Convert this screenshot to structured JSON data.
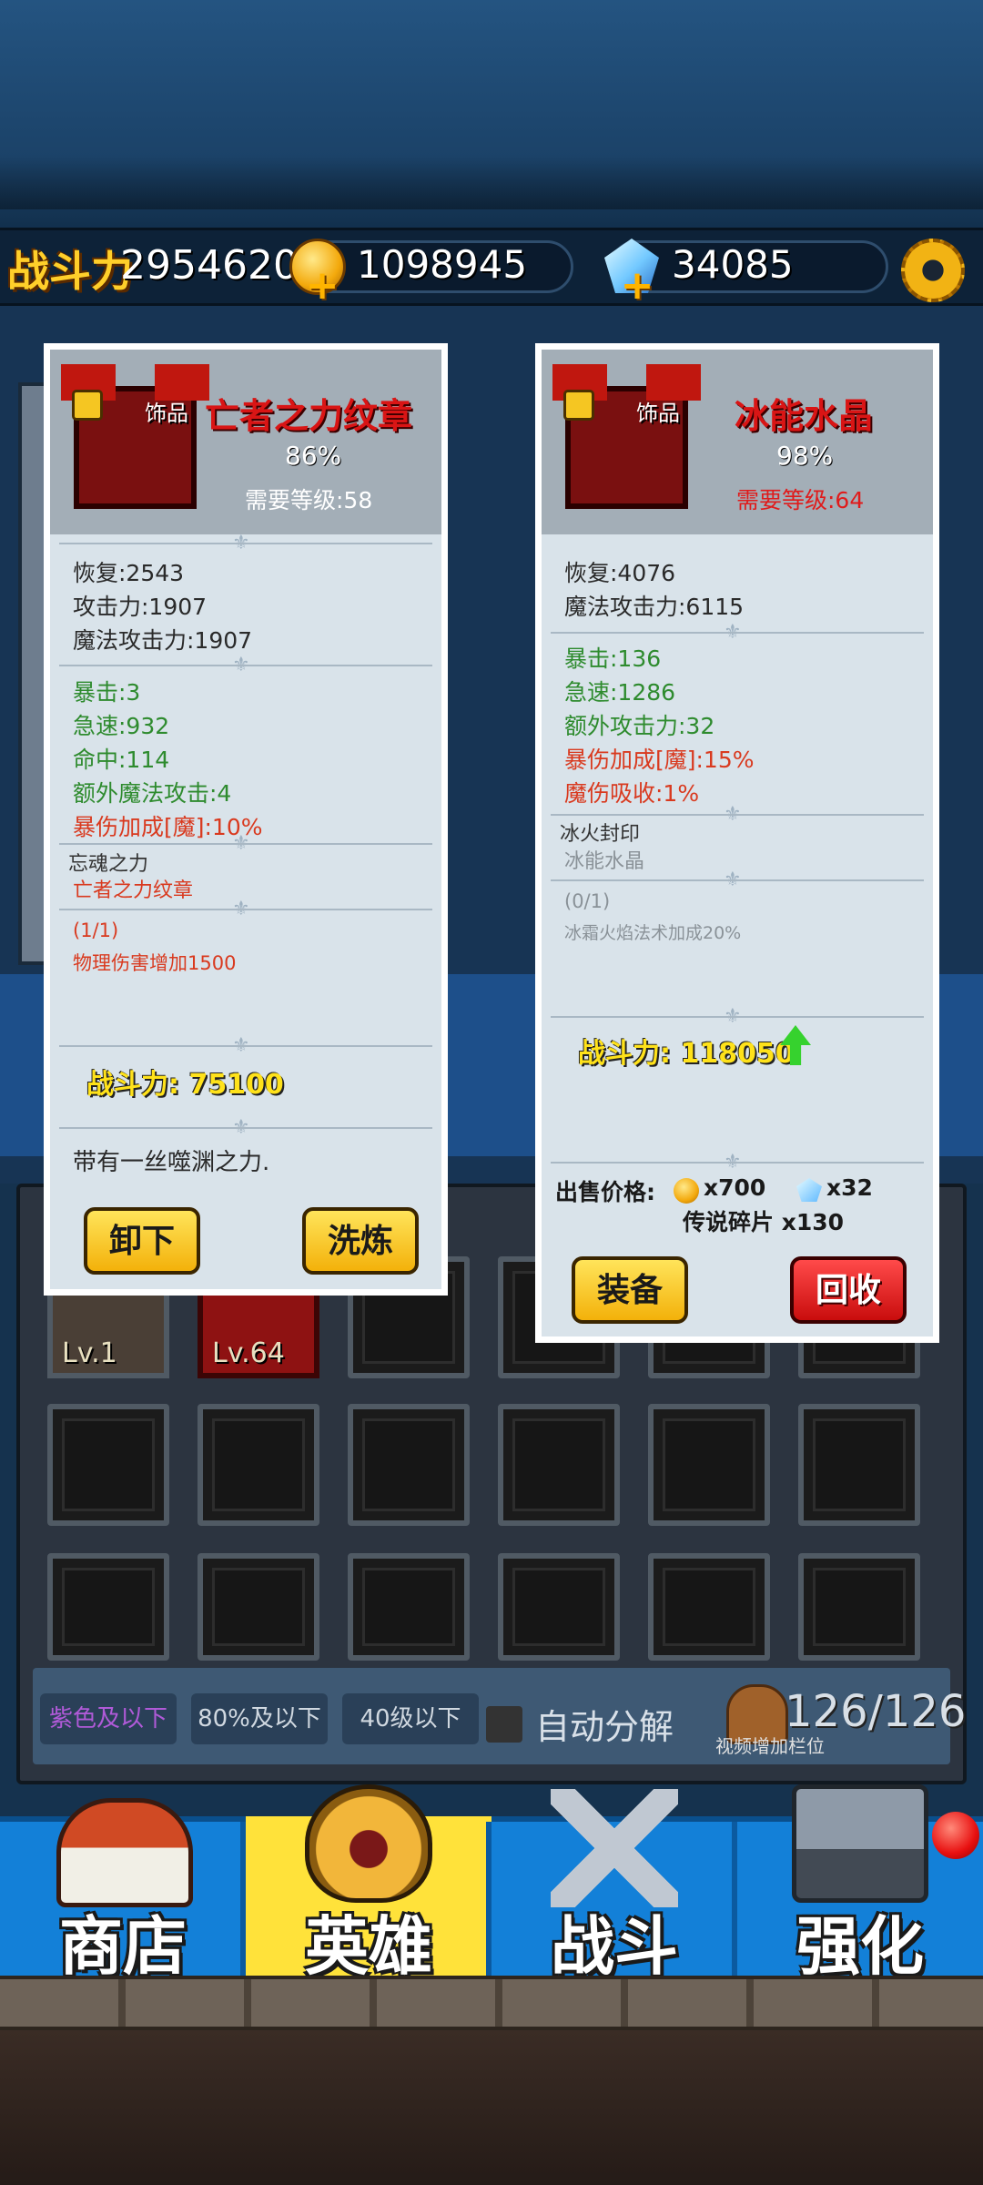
{
  "topbar": {
    "power_label": "战斗力",
    "power_value": "2954620",
    "gold": "1098945",
    "diamonds": "34085"
  },
  "left_item": {
    "tag": "饰品",
    "name": "亡者之力纹章",
    "percent": "86%",
    "required_level": "需要等级:58",
    "base_stats": [
      "恢复:2543",
      "攻击力:1907",
      "魔法攻击力:1907"
    ],
    "bonus_stats": [
      {
        "text": "暴击:3",
        "color": "green"
      },
      {
        "text": "急速:932",
        "color": "green"
      },
      {
        "text": "命中:114",
        "color": "green"
      },
      {
        "text": "额外魔法攻击:4",
        "color": "green"
      },
      {
        "text": "暴伤加成[魔]:10%",
        "color": "red"
      }
    ],
    "set_name": "忘魂之力",
    "set_piece": "亡者之力纹章",
    "set_progress": "(1/1)",
    "set_effect": "物理伤害增加1500",
    "power": "战斗力: 75100",
    "description": "带有一丝噬渊之力.",
    "btn_unequip": "卸下",
    "btn_refine": "洗炼"
  },
  "right_item": {
    "tag": "饰品",
    "name": "冰能水晶",
    "percent": "98%",
    "required_level": "需要等级:64",
    "base_stats": [
      "恢复:4076",
      "魔法攻击力:6115"
    ],
    "bonus_stats": [
      {
        "text": "暴击:136",
        "color": "green"
      },
      {
        "text": "急速:1286",
        "color": "green"
      },
      {
        "text": "额外攻击力:32",
        "color": "green"
      },
      {
        "text": "暴伤加成[魔]:15%",
        "color": "red"
      },
      {
        "text": "魔伤吸收:1%",
        "color": "red"
      }
    ],
    "set_name": "冰火封印",
    "set_piece": "冰能水晶",
    "set_progress": "(0/1)",
    "set_effect": "冰霜火焰法术加成20%",
    "power": "战斗力: 118050",
    "sell_label": "出售价格:",
    "sell_gold": "x700",
    "sell_diamond": "x32",
    "sell_shards": "传说碎片 x130",
    "btn_equip": "装备",
    "btn_recycle": "回收"
  },
  "inventory": {
    "slot_levels": [
      "Lv.1",
      "Lv.64"
    ],
    "filters": [
      "紫色及以下",
      "80%及以下",
      "40级以下"
    ],
    "auto_decompose": "自动分解",
    "capacity": "126/126",
    "capacity_note": "视频增加栏位"
  },
  "nav": {
    "tabs": [
      "商店",
      "英雄",
      "战斗",
      "强化"
    ],
    "active": "英雄"
  }
}
